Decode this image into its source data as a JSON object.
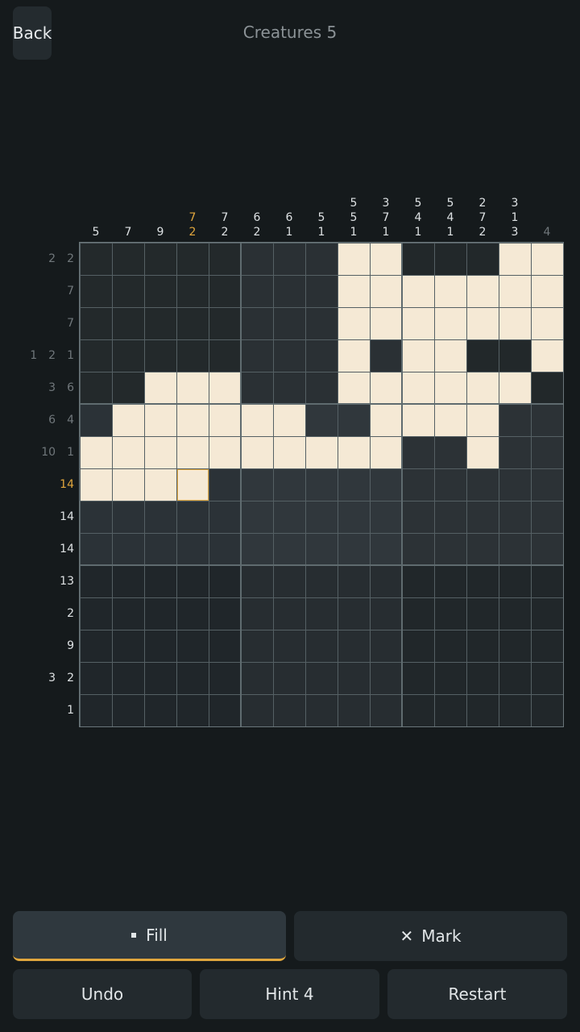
{
  "header": {
    "back_label": "Back",
    "title": "Creatures 5"
  },
  "puzzle": {
    "rows": 15,
    "cols": 15,
    "col_clues": [
      [
        "5"
      ],
      [
        "7"
      ],
      [
        "9"
      ],
      [
        "7",
        "2"
      ],
      [
        "7",
        "2"
      ],
      [
        "6",
        "2"
      ],
      [
        "6",
        "1"
      ],
      [
        "5",
        "1"
      ],
      [
        "5",
        "5",
        "1"
      ],
      [
        "3",
        "7",
        "1"
      ],
      [
        "5",
        "4",
        "1"
      ],
      [
        "5",
        "4",
        "1"
      ],
      [
        "2",
        "7",
        "2"
      ],
      [
        "3",
        "1",
        "3"
      ],
      [
        "4"
      ]
    ],
    "col_clue_states": [
      "",
      "",
      "",
      "active",
      "",
      "",
      "",
      "",
      "",
      "",
      "",
      "",
      "",
      "",
      "done"
    ],
    "row_clues": [
      [
        "2",
        "2"
      ],
      [
        "7"
      ],
      [
        "7"
      ],
      [
        "1",
        "2",
        "1"
      ],
      [
        "3",
        "6"
      ],
      [
        "6",
        "4"
      ],
      [
        "10",
        "1"
      ],
      [
        "14"
      ],
      [
        "14"
      ],
      [
        "14"
      ],
      [
        "13"
      ],
      [
        "2"
      ],
      [
        "9"
      ],
      [
        "3",
        "2"
      ],
      [
        "1"
      ]
    ],
    "row_clue_states": [
      "done",
      "done",
      "done",
      "done",
      "done",
      "done",
      "done",
      "active",
      "",
      "",
      "",
      "",
      "",
      "",
      ""
    ],
    "filled_rows": [
      "........XX...XX",
      "........XXXXXXX",
      "........XXXXXXX",
      "........X.XX..X",
      "..XXX...XXXXXX.",
      ".XXXXXX..XXXX..",
      "XXXXXXXXXX..X..",
      "XXXX...........",
      "...............",
      "...............",
      "...............",
      "...............",
      "...............",
      "...............",
      "..............."
    ],
    "cursor": {
      "row": 7,
      "col": 3
    },
    "colors": {
      "filled": "#f5e9d5",
      "accent": "#e0a63d"
    }
  },
  "controls": {
    "fill_label": "Fill",
    "mark_label": "Mark",
    "undo_label": "Undo",
    "hint_label": "Hint  4",
    "restart_label": "Restart",
    "mode": "fill"
  }
}
